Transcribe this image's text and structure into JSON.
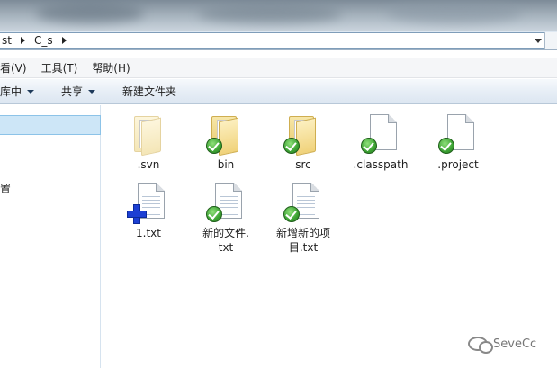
{
  "address": {
    "crumbs": [
      "st",
      "C_s"
    ]
  },
  "menu": {
    "items": [
      "查看(V)",
      "工具(T)",
      "帮助(H)"
    ],
    "first_visible": "看(V)"
  },
  "commandbar": {
    "library": "库中",
    "share": "共享",
    "new_folder": "新建文件夹"
  },
  "nav": {
    "partial_text": "置"
  },
  "files": [
    {
      "name": ".svn",
      "icon": "svn-folder-icon"
    },
    {
      "name": "bin",
      "icon": "versioned-folder-icon"
    },
    {
      "name": "src",
      "icon": "versioned-folder-icon"
    },
    {
      "name": ".classpath",
      "icon": "versioned-file-icon"
    },
    {
      "name": ".project",
      "icon": "versioned-file-icon"
    },
    {
      "name": "1.txt",
      "icon": "added-text-file-icon"
    },
    {
      "name": "新的文件.\ntxt",
      "icon": "versioned-text-file-icon"
    },
    {
      "name": "新增新的项\n目.txt",
      "icon": "versioned-text-file-icon"
    }
  ],
  "watermark": {
    "text": "SeveCc"
  }
}
